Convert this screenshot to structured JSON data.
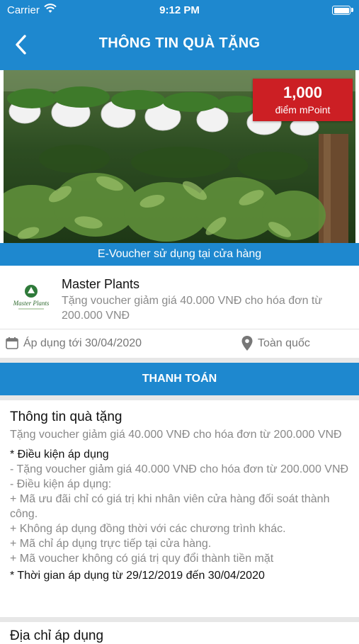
{
  "status_bar": {
    "carrier": "Carrier",
    "time": "9:12 PM"
  },
  "nav": {
    "title": "THÔNG TIN QUÀ TẶNG",
    "back_icon": "chevron-left-icon"
  },
  "hero": {
    "points_value": "1,000",
    "points_unit": "điểm mPoint"
  },
  "voucher_type": "E-Voucher sử dụng tại cửa hàng",
  "merchant": {
    "logo_text": "Master Plants",
    "name": "Master Plants",
    "description": "Tặng voucher giảm giá 40.000 VNĐ cho hóa đơn từ 200.000 VNĐ"
  },
  "validity": {
    "date": "Áp dụng tới 30/04/2020",
    "region": "Toàn quốc"
  },
  "pay_button": "THANH TOÁN",
  "details": {
    "title": "Thông tin quà tặng",
    "summary": "Tặng voucher giảm giá 40.000 VNĐ cho hóa đơn từ 200.000 VNĐ",
    "conditions_heading": "* Điều kiện áp dụng",
    "lines": [
      "- Tặng voucher giảm giá 40.000 VNĐ cho hóa đơn từ 200.000 VNĐ",
      "-  Điều kiện áp dụng:",
      "+ Mã ưu đãi chỉ có giá trị khi nhân viên cửa hàng đối soát thành công.",
      "+ Không áp dụng đồng thời với các chương trình khác.",
      "+ Mã chỉ áp dụng trực tiếp tại cửa hàng.",
      "+ Mã voucher không có giá trị quy đổi thành tiền mặt"
    ],
    "time_range": "* Thời gian áp dụng từ 29/12/2019 đến 30/04/2020"
  },
  "next_section_title": "Địa chỉ áp dụng",
  "colors": {
    "primary": "#1e88cf",
    "price_tag": "#cc1f24",
    "muted_text": "#888888"
  }
}
